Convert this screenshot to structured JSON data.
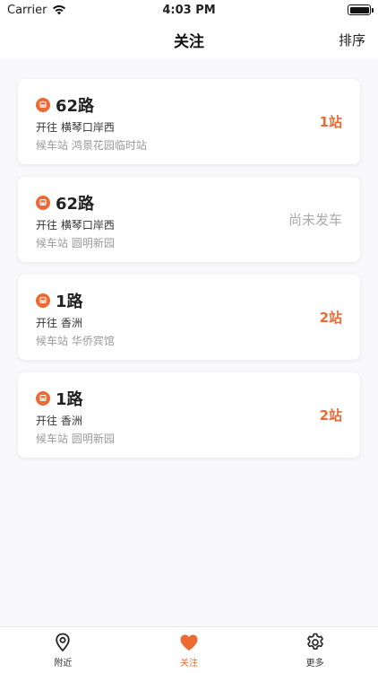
{
  "status_bar": {
    "carrier": "Carrier",
    "time": "4:03 PM"
  },
  "nav": {
    "title": "关注",
    "sort_label": "排序"
  },
  "colors": {
    "accent": "#ec6a33",
    "muted": "#aaaaaa",
    "background": "#f9f9fb"
  },
  "favorites": [
    {
      "route": "62路",
      "direction": "开往 横琴口岸西",
      "station": "候车站 鸿景花园临时站",
      "eta": "1站"
    },
    {
      "route": "62路",
      "direction": "开往 横琴口岸西",
      "station": "候车站 圆明新园",
      "eta": "尚未发车"
    },
    {
      "route": "1路",
      "direction": "开往 香洲",
      "station": "候车站 华侨宾馆",
      "eta": "2站"
    },
    {
      "route": "1路",
      "direction": "开往 香洲",
      "station": "候车站 圆明新园",
      "eta": "2站"
    }
  ],
  "tabs": [
    {
      "label": "附近",
      "icon": "location-pin-icon",
      "active": false
    },
    {
      "label": "关注",
      "icon": "heart-icon",
      "active": true
    },
    {
      "label": "更多",
      "icon": "gear-icon",
      "active": false
    }
  ]
}
